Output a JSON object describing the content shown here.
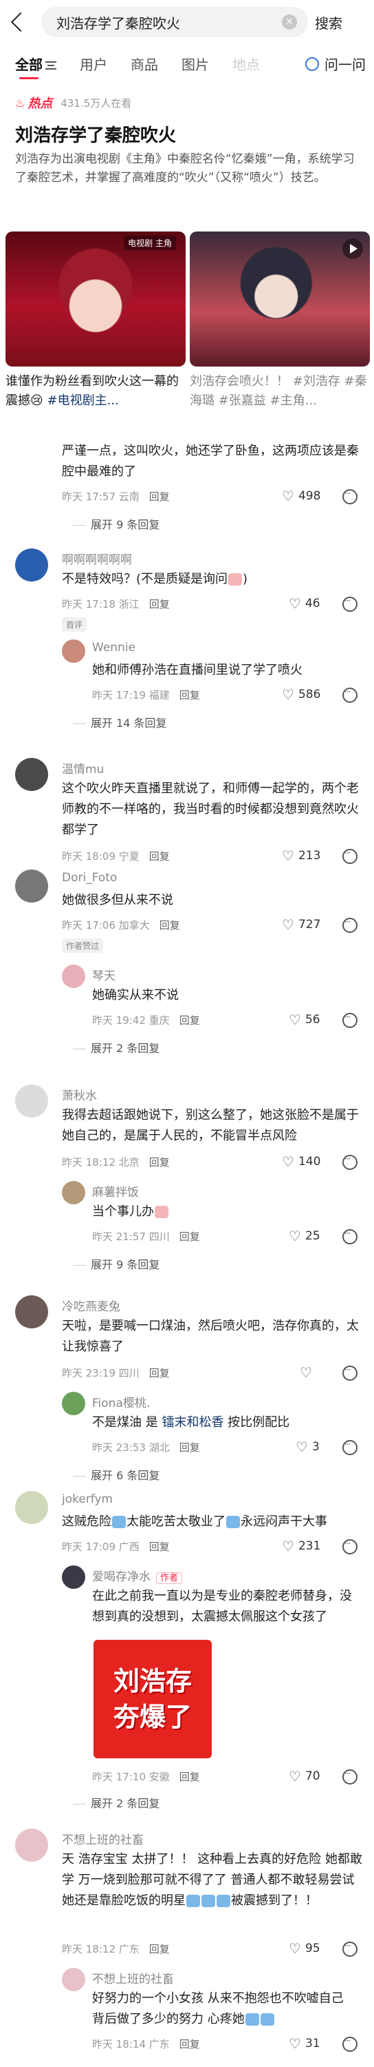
{
  "search": {
    "query": "刘浩存学了秦腔吹火",
    "button": "搜索"
  },
  "tabs": [
    "全部",
    "用户",
    "商品",
    "图片",
    "地点"
  ],
  "ask": "问一问",
  "hot": {
    "badge": "热点",
    "views": "431.5万人在看",
    "title": "刘浩存学了秦腔吹火",
    "description": "刘浩存为出演电视剧《主角》中秦腔名伶“忆秦娥”一角，系统学习了秦腔艺术，并掌握了高难度的“吹火”（又称“喷火”）技艺。"
  },
  "videos": [
    {
      "logo": "电视剧 主角",
      "caption_plain": "谁懂作为粉丝看到吹火这一幕的震撼😢 ",
      "caption_tag": "#电视剧主..."
    },
    {
      "caption_plain": "刘浩存会喷火！！ ",
      "caption_tag": "#刘浩存 #秦海璐 #张嘉益 #主角..."
    }
  ],
  "comments": [
    {
      "text": "严谨一点，这叫吹火，她还学了卧鱼，这两项应该是秦腔中最难的了",
      "time": "昨天 17:57 云南",
      "reply": "回复",
      "likes": "498",
      "expand": "展开 9 条回复"
    },
    {
      "nick": "啊啊啊啊啊啊",
      "text_a": "不是特效吗？(不是质疑是询问",
      "text_b": ")",
      "time": "昨天 17:18 浙江",
      "reply": "回复",
      "likes": "46",
      "chip": "首评",
      "sub": {
        "nick": "Wennie",
        "text": "她和师傅孙浩在直播间里说了学了喷火",
        "time": "昨天 17:19 福建",
        "reply": "回复",
        "likes": "586"
      },
      "expand": "展开 14 条回复"
    },
    {
      "nick": "温情mu",
      "text": "这个吹火昨天直播里就说了，和师傅一起学的，两个老师教的不一样咯的，我当时看的时候都没想到竟然吹火都学了",
      "time": "昨天 18:09 宁夏",
      "reply": "回复",
      "likes": "213"
    },
    {
      "nick": "Dori_Foto",
      "text": "她做很多但从来不说",
      "time": "昨天 17:06 加拿大",
      "reply": "回复",
      "likes": "727",
      "chip": "作者赞过",
      "sub": {
        "nick": "琴天",
        "text": "她确实从来不说",
        "time": "昨天 19:42 重庆",
        "reply": "回复",
        "likes": "56"
      },
      "expand": "展开 2 条回复"
    },
    {
      "nick": "萧秋水",
      "text": "我得去超话跟她说下，别这么整了，她这张脸不是属于她自己的，是属于人民的，不能冒半点风险",
      "time": "昨天 18:12 北京",
      "reply": "回复",
      "likes": "140",
      "sub": {
        "nick": "麻薯拌饭",
        "text": "当个事儿办",
        "time": "昨天 21:57 四川",
        "reply": "回复",
        "likes": "25"
      },
      "expand": "展开 9 条回复"
    },
    {
      "nick": "冷吃燕麦兔",
      "text": "天啦，是要喊一口煤油，然后喷火吧，浩存你真的，太让我惊喜了",
      "time": "昨天 23:19 四川",
      "reply": "回复",
      "sub": {
        "nick": "Fiona樱桃.",
        "text_a": "不是煤油 是 ",
        "link": "镭末和松香",
        "text_b": " 按比例配比",
        "time": "昨天 23:53 湖北",
        "reply": "回复",
        "likes": "3"
      },
      "expand": "展开 6 条回复"
    },
    {
      "nick": "jokerfym",
      "text_a": "这贼危险",
      "text_b": "太能吃苦太敬业了",
      "text_c": "永远闷声干大事",
      "time": "昨天 17:09 广西",
      "reply": "回复",
      "likes": "231",
      "sub": {
        "nick": "爱喝存净水",
        "author": "作者",
        "text": "在此之前我一直以为是专业的秦腔老师替身，没想到真的没想到，太震撼太佩服这个女孩了",
        "sticker_line1": "刘浩存",
        "sticker_line2": "夯爆了",
        "time": "昨天 17:10 安徽",
        "reply": "回复",
        "likes": "70"
      },
      "expand": "展开 2 条回复"
    },
    {
      "nick": "不想上班的社畜",
      "text_a": "天 浩存宝宝 太拼了！！ 这种看上去真的好危险 她都敢学 万一烧到脸那可就不得了了 普通人都不敢轻易尝试 她还是靠脸吃饭的明星",
      "text_b": "被震撼到了！！",
      "time": "昨天 18:12 广东",
      "reply": "回复",
      "likes": "95",
      "sub": {
        "nick": "不想上班的社畜",
        "text_a": "好努力的一个小女孩 从来不抱怨也不吹嘘自己背后做了多少的努力 心疼她",
        "time": "昨天 18:14 广东",
        "reply": "回复",
        "likes": "31"
      }
    }
  ],
  "colors": {
    "accent": "#ff2442",
    "link": "#13386c",
    "muted": "#999999"
  }
}
